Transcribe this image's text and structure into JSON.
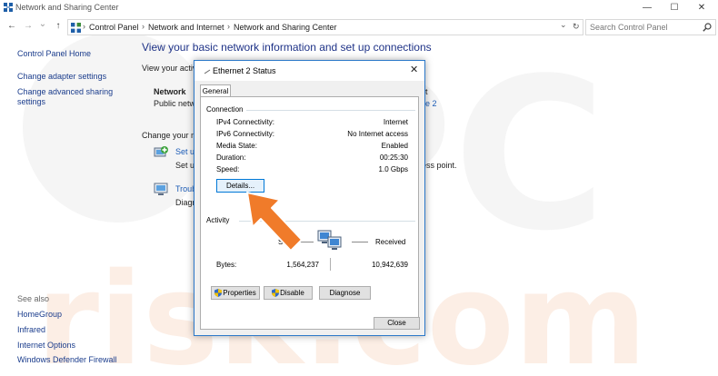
{
  "window": {
    "title": "Network and Sharing Center",
    "minimize": "—",
    "maximize": "☐",
    "close": "✕"
  },
  "nav": {
    "back": "←",
    "forward": "→",
    "recent": "⌄",
    "up": "↑",
    "refresh": "↻",
    "dropdown": "⌄",
    "breadcrumb": [
      "Control Panel",
      "Network and Internet",
      "Network and Sharing Center"
    ],
    "breadcrumb_sep": "›",
    "search_placeholder": "Search Control Panel"
  },
  "left_pane": {
    "home": "Control Panel Home",
    "links": [
      "Change adapter settings",
      "Change advanced sharing",
      "settings"
    ],
    "see_also": "See also",
    "see_also_links": [
      "HomeGroup",
      "Infrared",
      "Internet Options",
      "Windows Defender Firewall"
    ]
  },
  "main": {
    "title": "View your basic network information and set up connections",
    "view_active": "View your activ",
    "network_name": "Network",
    "network_type": "Public netw",
    "access_t": "t",
    "connections_link": "e 2",
    "change_settings": "Change your n",
    "setup_link": "Set u",
    "setup_desc": "Set u",
    "setup_desc_end": "ess point.",
    "troubleshoot_link": "Troub",
    "troubleshoot_desc": "Diagn"
  },
  "watermark": "PC risk.com",
  "dialog": {
    "title": "Ethernet 2 Status",
    "close": "✕",
    "tab": "General",
    "connection_group": "Connection",
    "rows": [
      {
        "label": "IPv4 Connectivity:",
        "value": "Internet"
      },
      {
        "label": "IPv6 Connectivity:",
        "value": "No Internet access"
      },
      {
        "label": "Media State:",
        "value": "Enabled"
      },
      {
        "label": "Duration:",
        "value": "00:25:30"
      },
      {
        "label": "Speed:",
        "value": "1.0 Gbps"
      }
    ],
    "details_button": "Details...",
    "activity_group": "Activity",
    "sent_label": "S",
    "received_label": "Received",
    "bytes_label": "Bytes:",
    "bytes_sent": "1,564,237",
    "bytes_received": "10,942,639",
    "properties_button": "Properties",
    "disable_button": "Disable",
    "diagnose_button": "Diagnose",
    "close_button": "Close"
  },
  "colors": {
    "accent": "#2b78c9",
    "link": "#1a5ab5",
    "title_blue": "#1e3287",
    "arrow": "#f07b2a"
  }
}
